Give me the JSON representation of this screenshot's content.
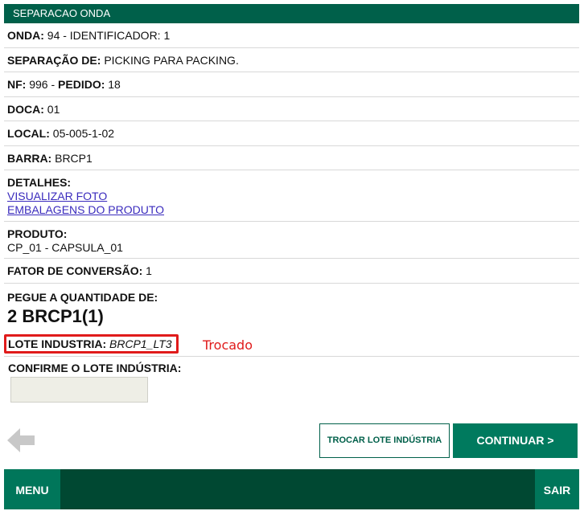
{
  "header": {
    "title": "SEPARACAO ONDA"
  },
  "fields": {
    "onda_label": "ONDA:",
    "onda_value": "94 - IDENTIFICADOR: 1",
    "separacao_label": "SEPARAÇÃO DE:",
    "separacao_value": "PICKING PARA PACKING.",
    "nf_label": "NF:",
    "nf_value": "996 -",
    "pedido_label": "PEDIDO:",
    "pedido_value": "18",
    "doca_label": "DOCA:",
    "doca_value": "01",
    "local_label": "LOCAL:",
    "local_value": "05-005-1-02",
    "barra_label": "BARRA:",
    "barra_value": "BRCP1",
    "detalhes_label": "DETALHES:",
    "link_foto": "VISUALIZAR FOTO",
    "link_embalagens": "EMBALAGENS DO PRODUTO",
    "produto_label": "PRODUTO:",
    "produto_value": "CP_01 - CAPSULA_01",
    "fator_label": "FATOR DE CONVERSÃO:",
    "fator_value": "1",
    "pegue_label": "PEGUE A QUANTIDADE DE:",
    "pegue_value": "2 BRCP1(1)",
    "lote_label": "LOTE INDUSTRIA:",
    "lote_value": "BRCP1_LT3",
    "annotation": "Trocado",
    "confirm_label": "CONFIRME O LOTE INDÚSTRIA:",
    "confirm_input_value": ""
  },
  "buttons": {
    "back_icon": "arrow-left-icon",
    "trocar": "TROCAR LOTE INDÚSTRIA",
    "continuar": "CONTINUAR >",
    "menu": "MENU",
    "sair": "SAIR"
  },
  "colors": {
    "primary": "#00604a",
    "footer": "#004832",
    "footer_button": "#00765a",
    "highlight": "#e01b1b",
    "link": "#3a2bbd"
  }
}
